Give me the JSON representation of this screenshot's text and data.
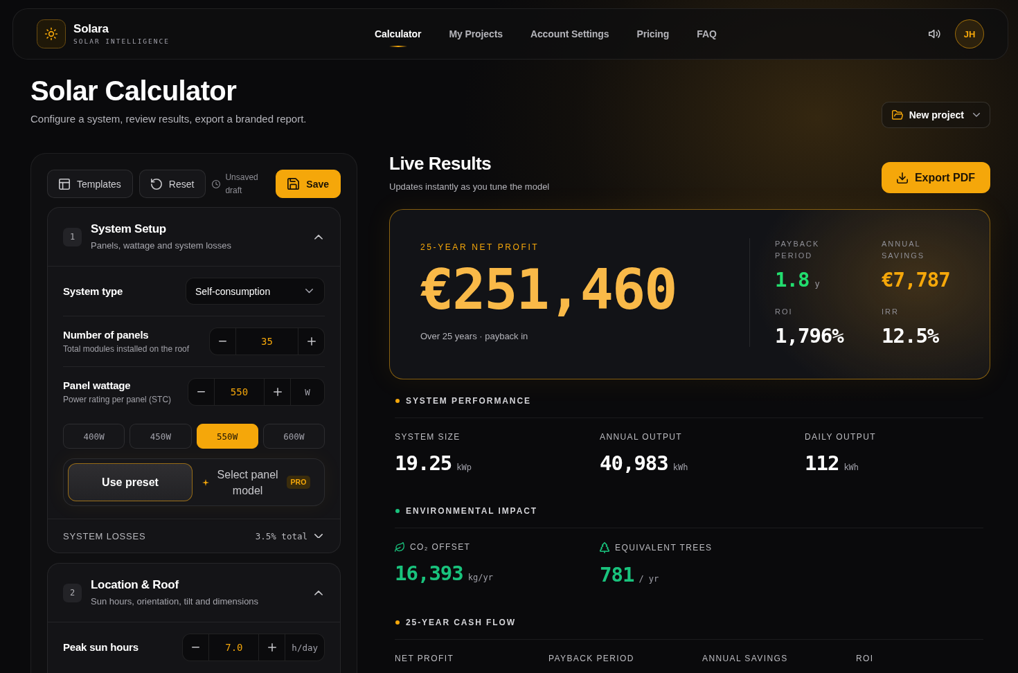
{
  "header": {
    "brand": {
      "name": "Solara",
      "tagline": "SOLAR INTELLIGENCE"
    },
    "nav": [
      {
        "label": "Calculator",
        "selected": true
      },
      {
        "label": "My Projects",
        "selected": false
      },
      {
        "label": "Account Settings",
        "selected": false
      },
      {
        "label": "Pricing",
        "selected": false
      },
      {
        "label": "FAQ",
        "selected": false
      }
    ],
    "avatar_initials": "JH"
  },
  "page": {
    "title": "Solar Calculator",
    "subtitle": "Configure a system, review results, export a branded report.",
    "new_project_button": "New project"
  },
  "toolbar": {
    "templates_button": "Templates",
    "reset_button": "Reset",
    "status": "Unsaved draft",
    "save_button": "Save"
  },
  "sections": [
    {
      "number": "1",
      "title": "System Setup",
      "subtitle": "Panels, wattage and system losses",
      "expanded": true,
      "fields": [
        {
          "kind": "select",
          "label": "System type",
          "value": "Self-consumption"
        },
        {
          "kind": "stepper",
          "label": "Number of panels",
          "hint": "Total modules installed on the roof",
          "value": "35"
        },
        {
          "kind": "stepper",
          "label": "Panel wattage",
          "hint": "Power rating per panel (STC)",
          "value": "550",
          "unit": "W"
        },
        {
          "kind": "chips",
          "options": [
            {
              "label": "400W",
              "selected": false
            },
            {
              "label": "450W",
              "selected": false
            },
            {
              "label": "550W",
              "selected": true
            },
            {
              "label": "600W",
              "selected": false
            }
          ]
        },
        {
          "kind": "segmented",
          "options": [
            {
              "label": "Use preset",
              "selected": true
            },
            {
              "label": "Select panel model",
              "selected": false,
              "badge": "PRO"
            }
          ]
        }
      ],
      "footer": {
        "label": "SYSTEM LOSSES",
        "value": "3.5% total",
        "expanded": false
      }
    },
    {
      "number": "2",
      "title": "Location & Roof",
      "subtitle": "Sun hours, orientation, tilt and dimensions",
      "expanded": true,
      "fields": [
        {
          "kind": "stepper",
          "label": "Peak sun hours",
          "value": "7.0",
          "unit": "h/day"
        }
      ]
    }
  ],
  "results": {
    "title": "Live Results",
    "subtitle": "Updates instantly as you tune the model",
    "export_button": "Export PDF",
    "summary": {
      "label": "25-YEAR NET PROFIT",
      "value": "€251,460",
      "caption": "Over 25 years · payback in",
      "metrics": [
        {
          "label": "PAYBACK PERIOD",
          "value": "1.8",
          "unit": "y",
          "color": "#22dd6e"
        },
        {
          "label": "ANNUAL SAVINGS",
          "value": "€7,787",
          "color": "#f5a70a"
        },
        {
          "label": "ROI",
          "value": "1,796%",
          "color": "#ffffff"
        },
        {
          "label": "IRR",
          "value": "12.5%",
          "color": "#ffffff"
        }
      ]
    },
    "groups": [
      {
        "title": "SYSTEM PERFORMANCE",
        "color": "#f5a70a",
        "kind": "stats",
        "stats": [
          {
            "label": "SYSTEM SIZE",
            "value": "19.25",
            "unit": "kWp"
          },
          {
            "label": "ANNUAL OUTPUT",
            "value": "40,983",
            "unit": "kWh"
          },
          {
            "label": "DAILY OUTPUT",
            "value": "112",
            "unit": "kWh"
          }
        ]
      },
      {
        "title": "ENVIRONMENTAL IMPACT",
        "color": "#19c37d",
        "kind": "impact",
        "stats": [
          {
            "label": "CO₂ OFFSET",
            "value": "16,393",
            "unit": "kg/yr"
          },
          {
            "label": "EQUIVALENT TREES",
            "value": "781",
            "unit": "/ yr"
          }
        ]
      },
      {
        "title": "25-YEAR CASH FLOW",
        "color": "#f5a70a",
        "kind": "stats",
        "stats": [
          {
            "label": "NET PROFIT"
          },
          {
            "label": "PAYBACK PERIOD"
          },
          {
            "label": "ANNUAL SAVINGS"
          },
          {
            "label": "ROI"
          }
        ]
      }
    ]
  }
}
